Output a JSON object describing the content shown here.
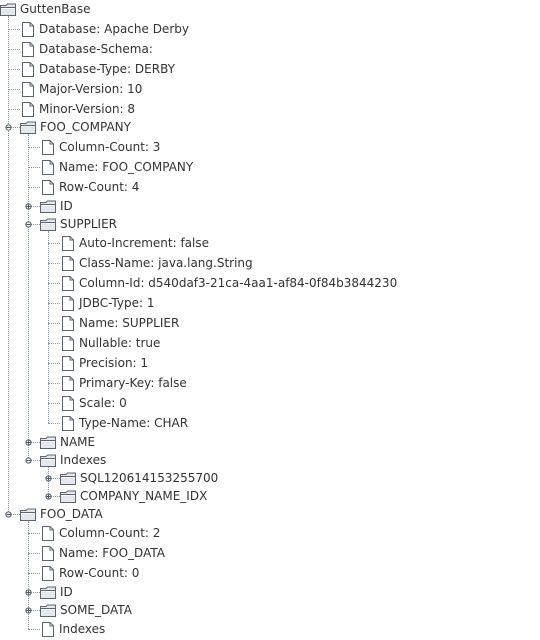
{
  "tree": [
    {
      "label": "GuttenBase",
      "type": "folder",
      "depth": 0,
      "expanded": true
    },
    {
      "label": "Database: Apache Derby",
      "type": "doc",
      "depth": 1
    },
    {
      "label": "Database-Schema:",
      "type": "doc",
      "depth": 1
    },
    {
      "label": "Database-Type: DERBY",
      "type": "doc",
      "depth": 1
    },
    {
      "label": "Major-Version: 10",
      "type": "doc",
      "depth": 1
    },
    {
      "label": "Minor-Version: 8",
      "type": "doc",
      "depth": 1
    },
    {
      "label": "FOO_COMPANY",
      "type": "folder",
      "depth": 1,
      "expanded": true
    },
    {
      "label": "Column-Count: 3",
      "type": "doc",
      "depth": 2
    },
    {
      "label": "Name: FOO_COMPANY",
      "type": "doc",
      "depth": 2
    },
    {
      "label": "Row-Count: 4",
      "type": "doc",
      "depth": 2
    },
    {
      "label": "ID",
      "type": "folder",
      "depth": 2,
      "expanded": false
    },
    {
      "label": "SUPPLIER",
      "type": "folder",
      "depth": 2,
      "expanded": true
    },
    {
      "label": "Auto-Increment: false",
      "type": "doc",
      "depth": 3
    },
    {
      "label": "Class-Name: java.lang.String",
      "type": "doc",
      "depth": 3
    },
    {
      "label": "Column-Id: d540daf3-21ca-4aa1-af84-0f84b3844230",
      "type": "doc",
      "depth": 3
    },
    {
      "label": "JDBC-Type: 1",
      "type": "doc",
      "depth": 3
    },
    {
      "label": "Name: SUPPLIER",
      "type": "doc",
      "depth": 3
    },
    {
      "label": "Nullable: true",
      "type": "doc",
      "depth": 3
    },
    {
      "label": "Precision: 1",
      "type": "doc",
      "depth": 3
    },
    {
      "label": "Primary-Key: false",
      "type": "doc",
      "depth": 3
    },
    {
      "label": "Scale: 0",
      "type": "doc",
      "depth": 3
    },
    {
      "label": "Type-Name: CHAR",
      "type": "doc",
      "depth": 3
    },
    {
      "label": "NAME",
      "type": "folder",
      "depth": 2,
      "expanded": false
    },
    {
      "label": "Indexes",
      "type": "folder",
      "depth": 2,
      "expanded": true
    },
    {
      "label": "SQL120614153255700",
      "type": "folder",
      "depth": 3,
      "expanded": false
    },
    {
      "label": "COMPANY_NAME_IDX",
      "type": "folder",
      "depth": 3,
      "expanded": false
    },
    {
      "label": "FOO_DATA",
      "type": "folder",
      "depth": 1,
      "expanded": true
    },
    {
      "label": "Column-Count: 2",
      "type": "doc",
      "depth": 2
    },
    {
      "label": "Name: FOO_DATA",
      "type": "doc",
      "depth": 2
    },
    {
      "label": "Row-Count: 0",
      "type": "doc",
      "depth": 2
    },
    {
      "label": "ID",
      "type": "folder",
      "depth": 2,
      "expanded": false
    },
    {
      "label": "SOME_DATA",
      "type": "folder",
      "depth": 2,
      "expanded": false
    },
    {
      "label": "Indexes",
      "type": "doc",
      "depth": 2
    }
  ],
  "colors": {
    "text": "#333333",
    "lines": "#8a98a8",
    "icon_stroke": "#5a6472",
    "folder_fill": "#e4e8ec"
  },
  "icons": {
    "doc": "document-icon",
    "folder": "folder-icon",
    "expanded": "expanded-handle-icon",
    "collapsed": "collapsed-handle-icon"
  }
}
